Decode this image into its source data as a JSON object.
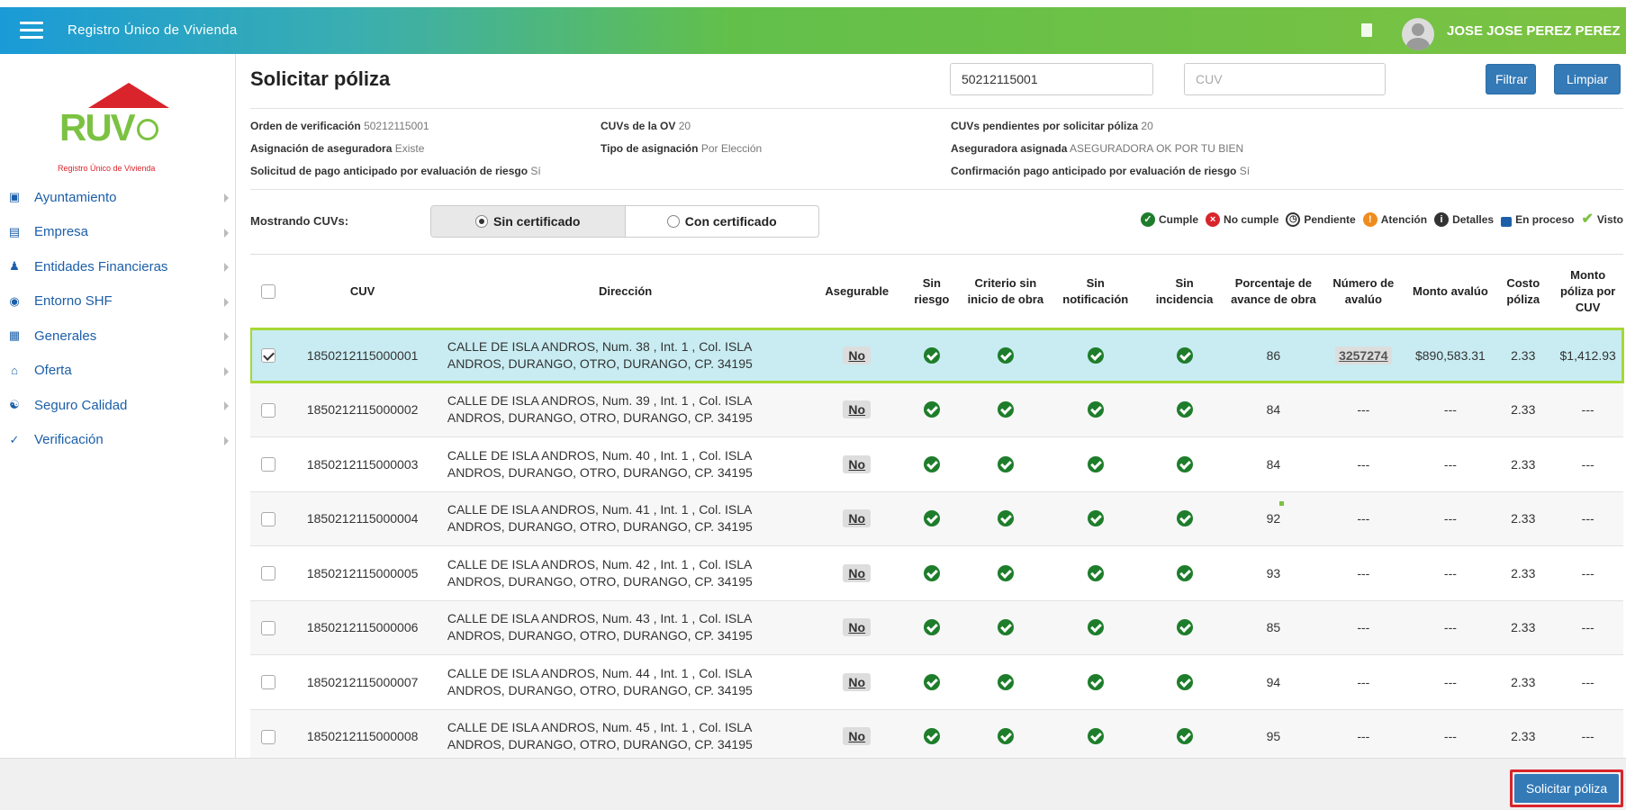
{
  "header": {
    "app_title": "Registro Único de Vivienda",
    "user_name": "JOSE JOSE PEREZ PEREZ"
  },
  "logo": {
    "text": "RUV",
    "subtitle": "Registro Único de Vivienda"
  },
  "sidebar": {
    "items": [
      {
        "label": "Ayuntamiento",
        "icon": "map-icon"
      },
      {
        "label": "Empresa",
        "icon": "building-icon"
      },
      {
        "label": "Entidades Financieras",
        "icon": "people-icon"
      },
      {
        "label": "Entorno SHF",
        "icon": "target-icon"
      },
      {
        "label": "Generales",
        "icon": "document-icon"
      },
      {
        "label": "Oferta",
        "icon": "house-icon"
      },
      {
        "label": "Seguro Calidad",
        "icon": "handshake-icon"
      },
      {
        "label": "Verificación",
        "icon": "check-circle-icon"
      }
    ]
  },
  "page": {
    "title": "Solicitar póliza",
    "filter_value": "50212115001",
    "cuv_placeholder": "CUV",
    "filter_button": "Filtrar",
    "clear_button": "Limpiar"
  },
  "info": {
    "orden_label": "Orden de verificación",
    "orden_value": "50212115001",
    "cuvs_ov_label": "CUVs de la OV",
    "cuvs_ov_value": "20",
    "cuvs_pend_label": "CUVs pendientes por solicitar póliza",
    "cuvs_pend_value": "20",
    "asig_label": "Asignación de aseguradora",
    "asig_value": "Existe",
    "tipo_label": "Tipo de asignación",
    "tipo_value": "Por Elección",
    "aseg_label": "Aseguradora asignada",
    "aseg_value": "ASEGURADORA OK POR TU BIEN",
    "sol_label": "Solicitud de pago anticipado por evaluación de riesgo",
    "sol_value": "Sí",
    "conf_label": "Confirmación pago anticipado por evaluación de riesgo",
    "conf_value": "Sí"
  },
  "filter_bar": {
    "showing_label": "Mostrando CUVs:",
    "option_without": "Sin certificado",
    "option_with": "Con certificado",
    "selected": "Sin certificado"
  },
  "legend": {
    "cumple": "Cumple",
    "no_cumple": "No cumple",
    "pendiente": "Pendiente",
    "atencion": "Atención",
    "detalles": "Detalles",
    "en_proceso": "En proceso",
    "visto": "Visto"
  },
  "table": {
    "headers": [
      "CUV",
      "Dirección",
      "Asegurable",
      "Sin riesgo",
      "Criterio sin inicio de obra",
      "Sin notificación",
      "Sin incidencia",
      "Porcentaje de avance de obra",
      "Número de avalúo",
      "Monto avalúo",
      "Costo póliza",
      "Monto póliza por CUV"
    ],
    "rows": [
      {
        "cuv": "1850212115000001",
        "addr1": "CALLE DE ISLA ANDROS, Num. 38 , Int. 1 , Col. ISLA",
        "addr2": "ANDROS, DURANGO, OTRO, DURANGO, CP. 34195",
        "asegurable": "No",
        "avance": "86",
        "avaluo": "3257274",
        "monto_avaluo": "$890,583.31",
        "costo": "2.33",
        "monto_poliza": "$1,412.93",
        "selected": true
      },
      {
        "cuv": "1850212115000002",
        "addr1": "CALLE DE ISLA ANDROS, Num. 39 , Int. 1 , Col. ISLA",
        "addr2": "ANDROS, DURANGO, OTRO, DURANGO, CP. 34195",
        "asegurable": "No",
        "avance": "84",
        "avaluo": "---",
        "monto_avaluo": "---",
        "costo": "2.33",
        "monto_poliza": "---",
        "selected": false
      },
      {
        "cuv": "1850212115000003",
        "addr1": "CALLE DE ISLA ANDROS, Num. 40 , Int. 1 , Col. ISLA",
        "addr2": "ANDROS, DURANGO, OTRO, DURANGO, CP. 34195",
        "asegurable": "No",
        "avance": "84",
        "avaluo": "---",
        "monto_avaluo": "---",
        "costo": "2.33",
        "monto_poliza": "---",
        "selected": false
      },
      {
        "cuv": "1850212115000004",
        "addr1": "CALLE DE ISLA ANDROS, Num. 41 , Int. 1 , Col. ISLA",
        "addr2": "ANDROS, DURANGO, OTRO, DURANGO, CP. 34195",
        "asegurable": "No",
        "avance": "92",
        "avaluo": "---",
        "monto_avaluo": "---",
        "costo": "2.33",
        "monto_poliza": "---",
        "selected": false
      },
      {
        "cuv": "1850212115000005",
        "addr1": "CALLE DE ISLA ANDROS, Num. 42 , Int. 1 , Col. ISLA",
        "addr2": "ANDROS, DURANGO, OTRO, DURANGO, CP. 34195",
        "asegurable": "No",
        "avance": "93",
        "avaluo": "---",
        "monto_avaluo": "---",
        "costo": "2.33",
        "monto_poliza": "---",
        "selected": false
      },
      {
        "cuv": "1850212115000006",
        "addr1": "CALLE DE ISLA ANDROS, Num. 43 , Int. 1 , Col. ISLA",
        "addr2": "ANDROS, DURANGO, OTRO, DURANGO, CP. 34195",
        "asegurable": "No",
        "avance": "85",
        "avaluo": "---",
        "monto_avaluo": "---",
        "costo": "2.33",
        "monto_poliza": "---",
        "selected": false
      },
      {
        "cuv": "1850212115000007",
        "addr1": "CALLE DE ISLA ANDROS, Num. 44 , Int. 1 , Col. ISLA",
        "addr2": "ANDROS, DURANGO, OTRO, DURANGO, CP. 34195",
        "asegurable": "No",
        "avance": "94",
        "avaluo": "---",
        "monto_avaluo": "---",
        "costo": "2.33",
        "monto_poliza": "---",
        "selected": false
      },
      {
        "cuv": "1850212115000008",
        "addr1": "CALLE DE ISLA ANDROS, Num. 45 , Int. 1 , Col. ISLA",
        "addr2": "ANDROS, DURANGO, OTRO, DURANGO, CP. 34195",
        "asegurable": "No",
        "avance": "95",
        "avaluo": "---",
        "monto_avaluo": "---",
        "costo": "2.33",
        "monto_poliza": "---",
        "selected": false
      }
    ]
  },
  "footer": {
    "submit_button": "Solicitar póliza"
  },
  "colors": {
    "brand_blue": "#337ab7",
    "brand_green": "#7cc242",
    "brand_red": "#d9242b",
    "ok_green": "#1e7d2b",
    "selected_row": "#c8ecf2"
  }
}
